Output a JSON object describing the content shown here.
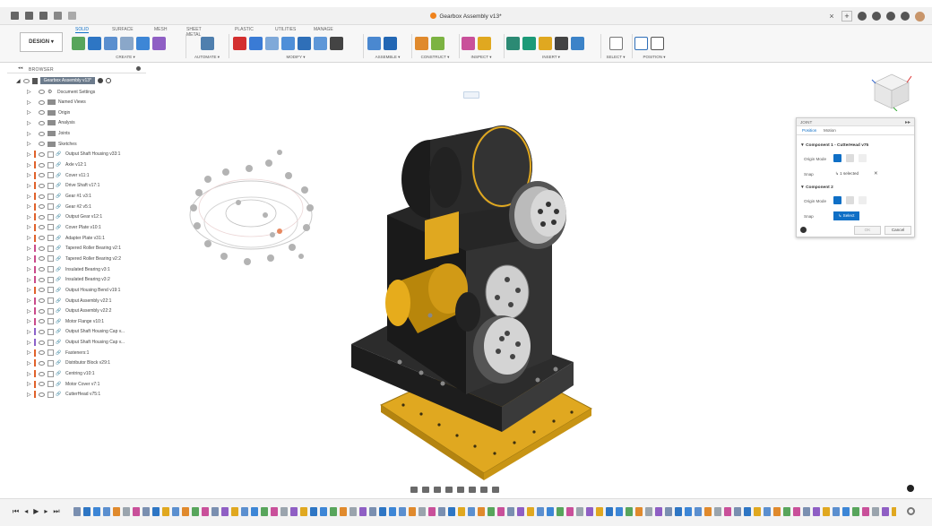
{
  "app": {
    "title": "Gearbox Assembly v13*"
  },
  "ribbon": {
    "workspace": "DESIGN",
    "tabs": [
      "SOLID",
      "SURFACE",
      "MESH",
      "SHEET METAL",
      "PLASTIC",
      "UTILITIES",
      "MANAGE"
    ],
    "groups": [
      "CREATE",
      "AUTOMATE",
      "MODIFY",
      "ASSEMBLE",
      "CONSTRUCT",
      "INSPECT",
      "INSERT",
      "SELECT",
      "POSITION"
    ]
  },
  "browser": {
    "title": "BROWSER",
    "root": "Gearbox Assembly v13*",
    "items": [
      {
        "label": "Document Settings",
        "kind": "gear"
      },
      {
        "label": "Named Views",
        "kind": "folder"
      },
      {
        "label": "Origin",
        "kind": "folder"
      },
      {
        "label": "Analysis",
        "kind": "folder"
      },
      {
        "label": "Joints",
        "kind": "folder"
      },
      {
        "label": "Sketches",
        "kind": "folder"
      },
      {
        "label": "Output Shaft Housing v33:1",
        "color": "#e0612a"
      },
      {
        "label": "Axle v12:1",
        "color": "#e0612a"
      },
      {
        "label": "Cover v11:1",
        "color": "#e0612a"
      },
      {
        "label": "Drive Shaft v17:1",
        "color": "#e0612a"
      },
      {
        "label": "Gear #1 v3:1",
        "color": "#e0612a"
      },
      {
        "label": "Gear #2 v5:1",
        "color": "#e0612a"
      },
      {
        "label": "Output Gear v12:1",
        "color": "#e0612a"
      },
      {
        "label": "Cover Plate v10:1",
        "color": "#e0612a"
      },
      {
        "label": "Adapter Plate v31:1",
        "color": "#e0612a"
      },
      {
        "label": "Tapered Roller Bearing v2:1",
        "color": "#c94a8a"
      },
      {
        "label": "Tapered Roller Bearing v2:2",
        "color": "#c94a8a"
      },
      {
        "label": "Insulated Bearing v3:1",
        "color": "#c94a8a"
      },
      {
        "label": "Insulated Bearing v3:2",
        "color": "#c94a8a"
      },
      {
        "label": "Output Housing Bend v19:1",
        "color": "#e0612a"
      },
      {
        "label": "Output Assembly v22:1",
        "color": "#c94a8a"
      },
      {
        "label": "Output Assembly v22:2",
        "color": "#c94a8a"
      },
      {
        "label": "Motor Flange v10:1",
        "color": "#c94a8a"
      },
      {
        "label": "Output Shaft Housing Cap v...",
        "color": "#8b61c9"
      },
      {
        "label": "Output Shaft Housing Cap v...",
        "color": "#8b61c9"
      },
      {
        "label": "Fasteners:1",
        "color": "#e0612a"
      },
      {
        "label": "Distributor Block v29:1",
        "color": "#e0612a"
      },
      {
        "label": "Centring v10:1",
        "color": "#e0612a"
      },
      {
        "label": "Motor Cover v7:1",
        "color": "#e0612a"
      },
      {
        "label": "CutterHead v75:1",
        "color": "#e0612a"
      }
    ]
  },
  "joint": {
    "title": "JOINT",
    "tab_position": "Position",
    "tab_motion": "Motion",
    "comp1": "Component 1 - CutterHead v75",
    "comp2": "Component 2",
    "origin_mode": "Origin Mode",
    "snap": "Snap",
    "selected": "1 selected",
    "snap_btn": "Select",
    "ok": "OK",
    "cancel": "Cancel"
  },
  "colors": {
    "accent": "#0f6fc6",
    "brand_orange": "#f0831c",
    "gold": "#e0a820"
  }
}
